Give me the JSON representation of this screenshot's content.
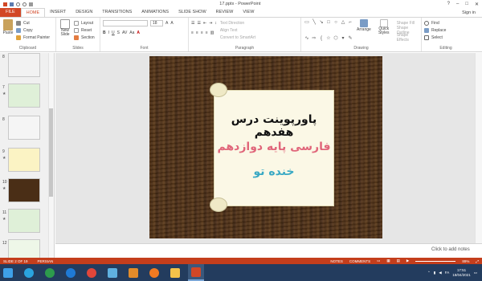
{
  "window": {
    "title": "17.pptx - PowerPoint",
    "signin": "Sign in"
  },
  "tabs": [
    "FILE",
    "HOME",
    "INSERT",
    "DESIGN",
    "TRANSITIONS",
    "ANIMATIONS",
    "SLIDE SHOW",
    "REVIEW",
    "VIEW"
  ],
  "ribbon": {
    "clipboard": {
      "paste": "Paste",
      "cut": "Cut",
      "copy": "Copy",
      "format_painter": "Format Painter",
      "label": "Clipboard"
    },
    "slides": {
      "new_slide": "New Slide",
      "layout": "Layout",
      "reset": "Reset",
      "section": "Section",
      "label": "Slides"
    },
    "font": {
      "size": "18",
      "label": "Font"
    },
    "paragraph": {
      "text_direction": "Text Direction",
      "align_text": "Align Text",
      "convert": "Convert to SmartArt",
      "label": "Paragraph"
    },
    "drawing": {
      "arrange": "Arrange",
      "quick_styles": "Quick Styles",
      "shape_fill": "Shape Fill",
      "shape_outline": "Shape Outline",
      "shape_effects": "Shape Effects",
      "label": "Drawing"
    },
    "editing": {
      "find": "Find",
      "replace": "Replace",
      "select": "Select",
      "label": "Editing"
    }
  },
  "thumbnails": [
    {
      "num": "8",
      "color": "#f2f2f2"
    },
    {
      "num": "7",
      "color": "#dff0d8"
    },
    {
      "num": "8",
      "color": "#f5f5f5"
    },
    {
      "num": "9",
      "color": "#fbf3c4"
    },
    {
      "num": "10",
      "color": "#4a2e16"
    },
    {
      "num": "11",
      "color": "#dff0d8"
    },
    {
      "num": "12",
      "color": "#eef7e8"
    }
  ],
  "slide": {
    "title": "پاورپوینت درس هفدهم",
    "subtitle": "فارسی پایه دوازدهم",
    "lesson": "خنده تو"
  },
  "notes_placeholder": "Click to add notes",
  "status": {
    "slide": "SLIDE 2 OF 19",
    "language": "PERSIAN",
    "notes": "NOTES",
    "comments": "COMMENTS",
    "zoom": "89%"
  },
  "taskbar": {
    "time": "17:51",
    "date": "18/04/2021",
    "lang": "FA"
  }
}
